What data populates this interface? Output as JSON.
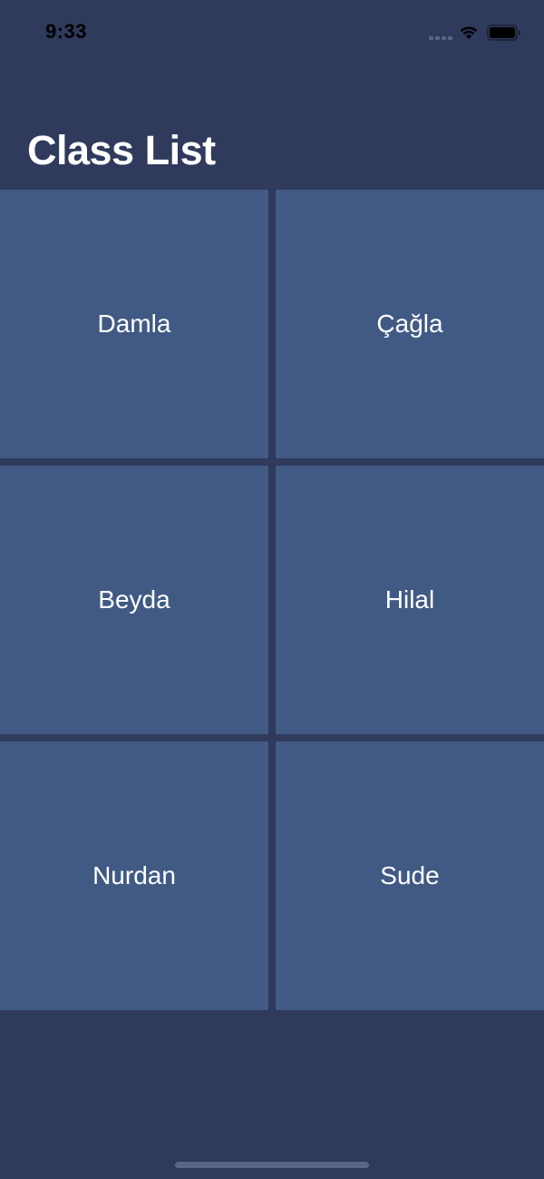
{
  "status_bar": {
    "time": "9:33",
    "wifi_icon": "wifi-icon",
    "battery_icon": "battery-icon",
    "signal_icon": "signal-dots-icon"
  },
  "header": {
    "title": "Class List"
  },
  "students": [
    {
      "name": "Damla"
    },
    {
      "name": "Çağla"
    },
    {
      "name": "Beyda"
    },
    {
      "name": "Hilal"
    },
    {
      "name": "Nurdan"
    },
    {
      "name": "Sude"
    }
  ],
  "colors": {
    "background": "#2f3a5c",
    "cell": "#415a84",
    "text": "#ffffff"
  }
}
